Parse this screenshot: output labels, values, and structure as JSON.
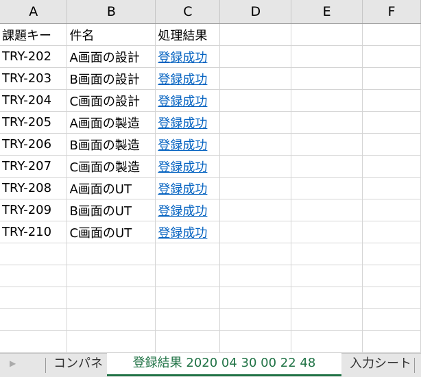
{
  "columns": [
    "A",
    "B",
    "C",
    "D",
    "E",
    "F"
  ],
  "rows": [
    [
      "課題キー",
      "件名",
      "処理結果"
    ],
    [
      "TRY-202",
      "A画面の設計",
      "登録成功"
    ],
    [
      "TRY-203",
      "B画面の設計",
      "登録成功"
    ],
    [
      "TRY-204",
      "C画面の設計",
      "登録成功"
    ],
    [
      "TRY-205",
      "A画面の製造",
      "登録成功"
    ],
    [
      "TRY-206",
      "B画面の製造",
      "登録成功"
    ],
    [
      "TRY-207",
      "C画面の製造",
      "登録成功"
    ],
    [
      "TRY-208",
      "A画面のUT",
      "登録成功"
    ],
    [
      "TRY-209",
      "B画面のUT",
      "登録成功"
    ],
    [
      "TRY-210",
      "C画面のUT",
      "登録成功"
    ]
  ],
  "sheet_tabs": [
    "コンパネ",
    "登録結果 2020 04 30 00 22 48",
    "入力シート"
  ],
  "active_tab": 1
}
